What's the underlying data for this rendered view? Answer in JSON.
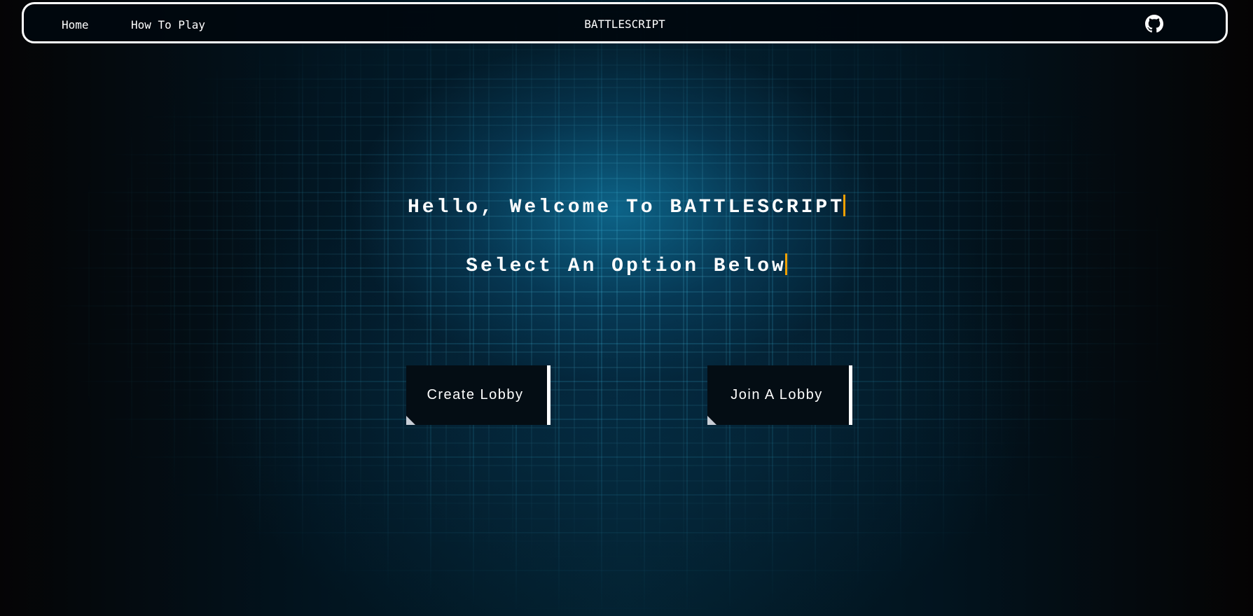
{
  "nav": {
    "home_label": "Home",
    "how_to_play_label": "How To Play",
    "site_title": "BATTLESCRIPT",
    "github_icon": "github-icon"
  },
  "hero": {
    "welcome_text": "Hello, Welcome To BATTLESCRIPT",
    "prompt_text": "Select An Option Below"
  },
  "actions": {
    "create_lobby_label": "Create Lobby",
    "join_lobby_label": "Join A Lobby"
  },
  "colors": {
    "caret": "#f0a000",
    "text": "#ffffff",
    "button_bg": "#040d14",
    "accent_glow": "#0e6e96"
  }
}
